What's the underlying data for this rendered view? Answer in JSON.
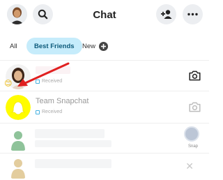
{
  "header": {
    "title": "Chat",
    "icons": [
      "bitmoji-avatar-icon",
      "search-icon",
      "add-friend-icon",
      "more-icon"
    ]
  },
  "tabs": [
    {
      "label": "All"
    },
    {
      "label": "Best Friends",
      "selected": true
    },
    {
      "label": "New"
    }
  ],
  "chats": [
    {
      "name": "",
      "status": "Received",
      "action_icon": "camera-icon",
      "emoji": "😊",
      "annotation": "red-arrow"
    },
    {
      "name": "Team Snapchat",
      "status": "Received",
      "action_icon": "camera-icon"
    },
    {
      "name": "",
      "status": "",
      "action_icon": "snap-badge",
      "action_label": "Snap"
    },
    {
      "name": "",
      "status": "",
      "action_icon": "close-icon"
    }
  ],
  "colors": {
    "tab_selected_bg": "#c6ecfb",
    "snapchat_yellow": "#fffc00",
    "arrow": "#e02020",
    "received_icon": "#47b1e0"
  }
}
